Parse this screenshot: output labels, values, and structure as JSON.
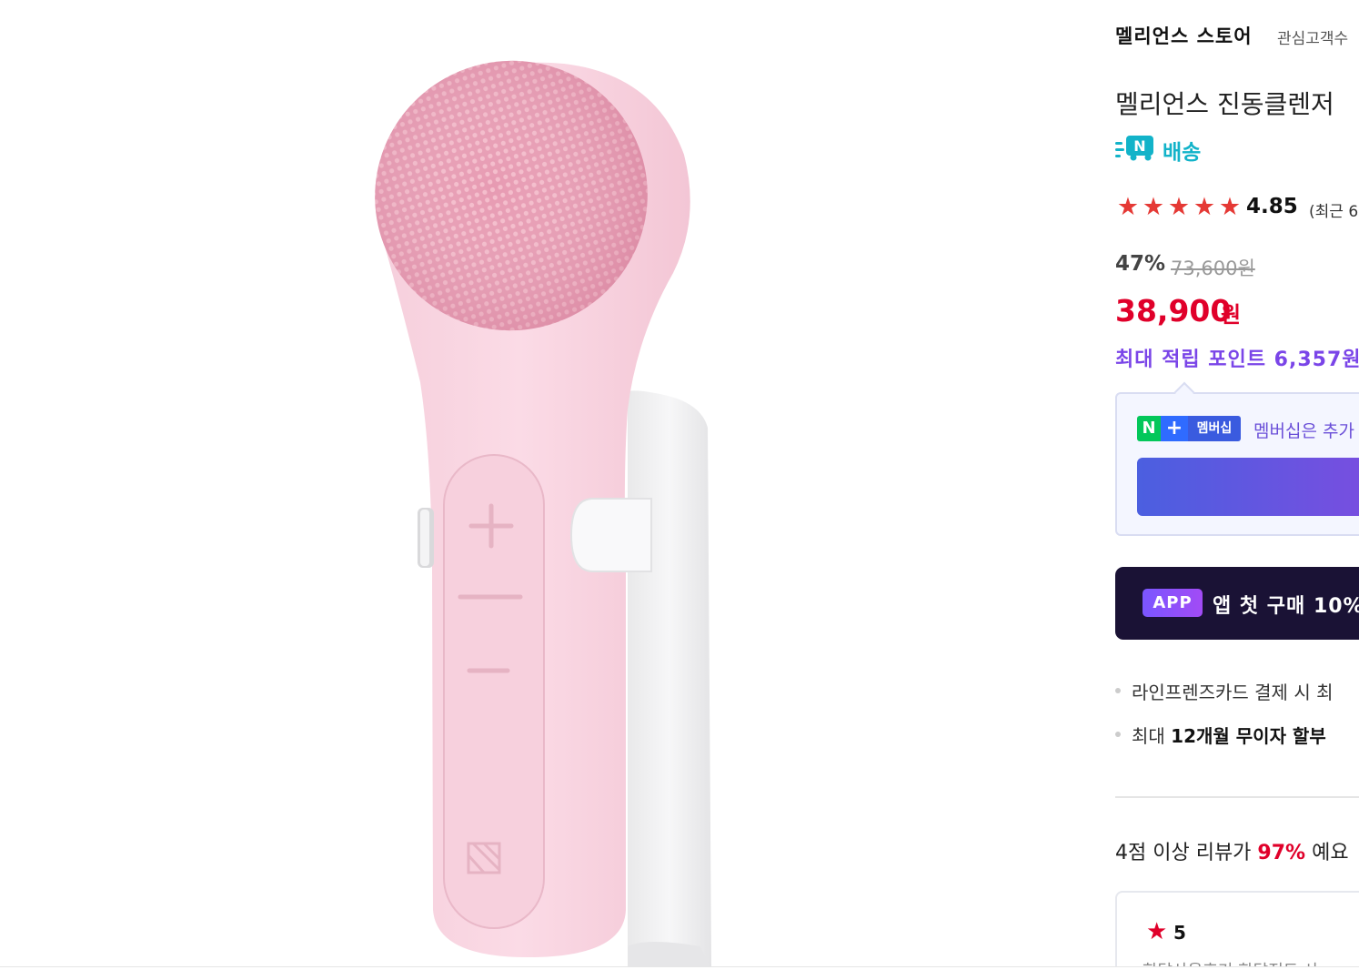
{
  "store": {
    "name": "멜리언스 스토어",
    "meta": "관심고객수"
  },
  "product": {
    "title": "멜리언스 진동클렌저",
    "image_alt": "pink facial cleansing brush"
  },
  "delivery": {
    "badge": "N",
    "label": "배송",
    "icon": "n-delivery-truck-icon",
    "color": "#12b3c9"
  },
  "rating": {
    "stars": [
      "★",
      "★",
      "★",
      "★",
      "★"
    ],
    "value": "4.85",
    "note": "(최근 6"
  },
  "pricing": {
    "discount": "47%",
    "original": "73,600원",
    "sale": "38,900",
    "sale_unit": "원",
    "points": "최대 적립 포인트 6,357원",
    "sale_color": "#e0002a",
    "points_color": "#7a45e8"
  },
  "membership": {
    "badge_n": "N",
    "badge_plus": "+",
    "badge_label": "멤버십",
    "text": "멤버십은 추가"
  },
  "app_banner": {
    "badge": "APP",
    "text": "앱 첫 구매 10%"
  },
  "benefits": [
    {
      "text": "라인프렌즈카드 결제 시 최"
    },
    {
      "prefix": "최대 ",
      "bold": "12개월 무이자 할부"
    }
  ],
  "reviews": {
    "summary_prefix": "4점 이상 리뷰가 ",
    "summary_pct": "97%",
    "summary_suffix": " 예요",
    "card_star": "★",
    "card_score": "5",
    "card_snippet": "한달사용후기 한달전도 사"
  }
}
